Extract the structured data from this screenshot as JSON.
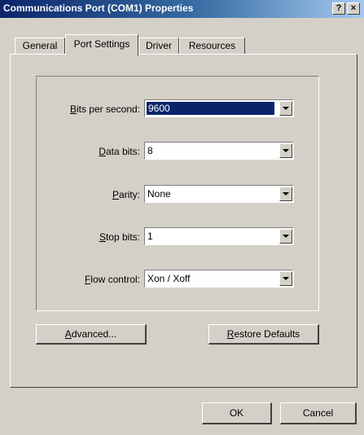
{
  "window": {
    "title": "Communications Port (COM1) Properties",
    "help_label": "?",
    "close_label": "×"
  },
  "tabs": [
    {
      "label": "General",
      "active": false
    },
    {
      "label": "Port Settings",
      "active": true
    },
    {
      "label": "Driver",
      "active": false
    },
    {
      "label": "Resources",
      "active": false
    }
  ],
  "settings": [
    {
      "accel": "B",
      "rest": "its per second:",
      "value": "9600",
      "highlighted": true
    },
    {
      "accel": "D",
      "rest": "ata bits:",
      "value": "8"
    },
    {
      "accel": "P",
      "rest": "arity:",
      "value": "None"
    },
    {
      "accel": "S",
      "rest": "top bits:",
      "value": "1"
    },
    {
      "accel": "F",
      "rest": "low control:",
      "value": "Xon / Xoff"
    }
  ],
  "buttons": {
    "advanced": {
      "accel": "A",
      "rest": "dvanced..."
    },
    "restore": {
      "accel": "R",
      "rest": "estore Defaults"
    },
    "ok": "OK",
    "cancel": "Cancel"
  }
}
